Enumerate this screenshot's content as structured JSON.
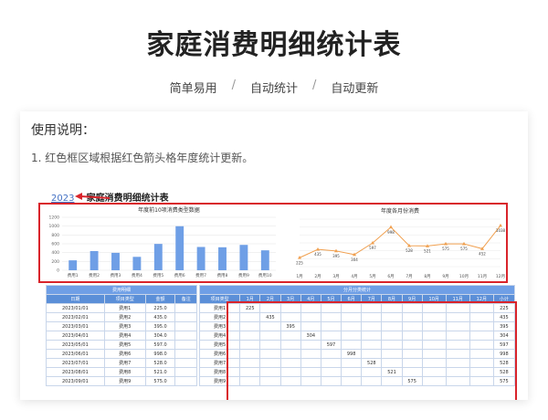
{
  "page_title": "家庭消费明细统计表",
  "tags": [
    "简单易用",
    "自动统计",
    "自动更新"
  ],
  "tag_sep": "/",
  "usage": {
    "title": "使用说明：",
    "step1": "1. 红色框区域根据红色箭头格年度统计更新。"
  },
  "sheet": {
    "year": "2023",
    "title": "家庭消费明细统计表"
  },
  "colors": {
    "accent_blue": "#5b8fd8",
    "red": "#d9242b",
    "orange": "#f0a050",
    "bar": "#6f9fe6"
  },
  "chart_data": [
    {
      "type": "bar",
      "title": "年度前10项消费类型数据",
      "categories": [
        "费用1",
        "费用2",
        "费用3",
        "费用4",
        "费用5",
        "费用6",
        "费用7",
        "费用8",
        "费用9",
        "费用10"
      ],
      "values": [
        225,
        435,
        395,
        304,
        597,
        998,
        528,
        521,
        575,
        452
      ],
      "yticks": [
        0,
        200,
        400,
        600,
        800,
        1000,
        1200
      ],
      "ylim": [
        0,
        1200
      ],
      "grid": true
    },
    {
      "type": "line",
      "title": "年度各月份消费",
      "categories": [
        "1月",
        "2月",
        "3月",
        "4月",
        "5月",
        "6月",
        "7月",
        "8月",
        "9月",
        "10月",
        "11月",
        "12月"
      ],
      "values": [
        225,
        435,
        395,
        304,
        597,
        998,
        528,
        521,
        575,
        575,
        452,
        1038
      ],
      "ylim": [
        0,
        1200
      ],
      "grid": true
    }
  ],
  "left_table": {
    "band": "费用明细",
    "headers": [
      "日期",
      "项目类型",
      "金额",
      "备注"
    ],
    "rows": [
      [
        "2023/01/01",
        "费用1",
        "225.0",
        ""
      ],
      [
        "2023/02/01",
        "费用2",
        "435.0",
        ""
      ],
      [
        "2023/03/01",
        "费用3",
        "395.0",
        ""
      ],
      [
        "2023/04/01",
        "费用4",
        "304.0",
        ""
      ],
      [
        "2023/05/01",
        "费用5",
        "597.0",
        ""
      ],
      [
        "2023/06/01",
        "费用6",
        "998.0",
        ""
      ],
      [
        "2023/07/01",
        "费用7",
        "528.0",
        ""
      ],
      [
        "2023/08/01",
        "费用8",
        "521.0",
        ""
      ],
      [
        "2023/09/01",
        "费用9",
        "575.0",
        ""
      ]
    ]
  },
  "right_table": {
    "band": "分月分类统计",
    "headers": [
      "项目类型",
      "1月",
      "2月",
      "3月",
      "4月",
      "5月",
      "6月",
      "7月",
      "8月",
      "9月",
      "10月",
      "11月",
      "12月",
      "小计"
    ],
    "rows": [
      [
        "费用1",
        "225",
        "",
        "",
        "",
        "",
        "",
        "",
        "",
        "",
        "",
        "",
        "",
        "225"
      ],
      [
        "费用2",
        "",
        "435",
        "",
        "",
        "",
        "",
        "",
        "",
        "",
        "",
        "",
        "",
        "435"
      ],
      [
        "费用3",
        "",
        "",
        "395",
        "",
        "",
        "",
        "",
        "",
        "",
        "",
        "",
        "",
        "395"
      ],
      [
        "费用4",
        "",
        "",
        "",
        "304",
        "",
        "",
        "",
        "",
        "",
        "",
        "",
        "",
        "304"
      ],
      [
        "费用5",
        "",
        "",
        "",
        "",
        "597",
        "",
        "",
        "",
        "",
        "",
        "",
        "",
        "597"
      ],
      [
        "费用6",
        "",
        "",
        "",
        "",
        "",
        "998",
        "",
        "",
        "",
        "",
        "",
        "",
        "998"
      ],
      [
        "费用7",
        "",
        "",
        "",
        "",
        "",
        "",
        "528",
        "",
        "",
        "",
        "",
        "",
        "528"
      ],
      [
        "费用8",
        "",
        "",
        "",
        "",
        "",
        "",
        "",
        "521",
        "",
        "",
        "",
        "",
        "528"
      ],
      [
        "费用9",
        "",
        "",
        "",
        "",
        "",
        "",
        "",
        "",
        "575",
        "",
        "",
        "",
        "575"
      ]
    ]
  }
}
